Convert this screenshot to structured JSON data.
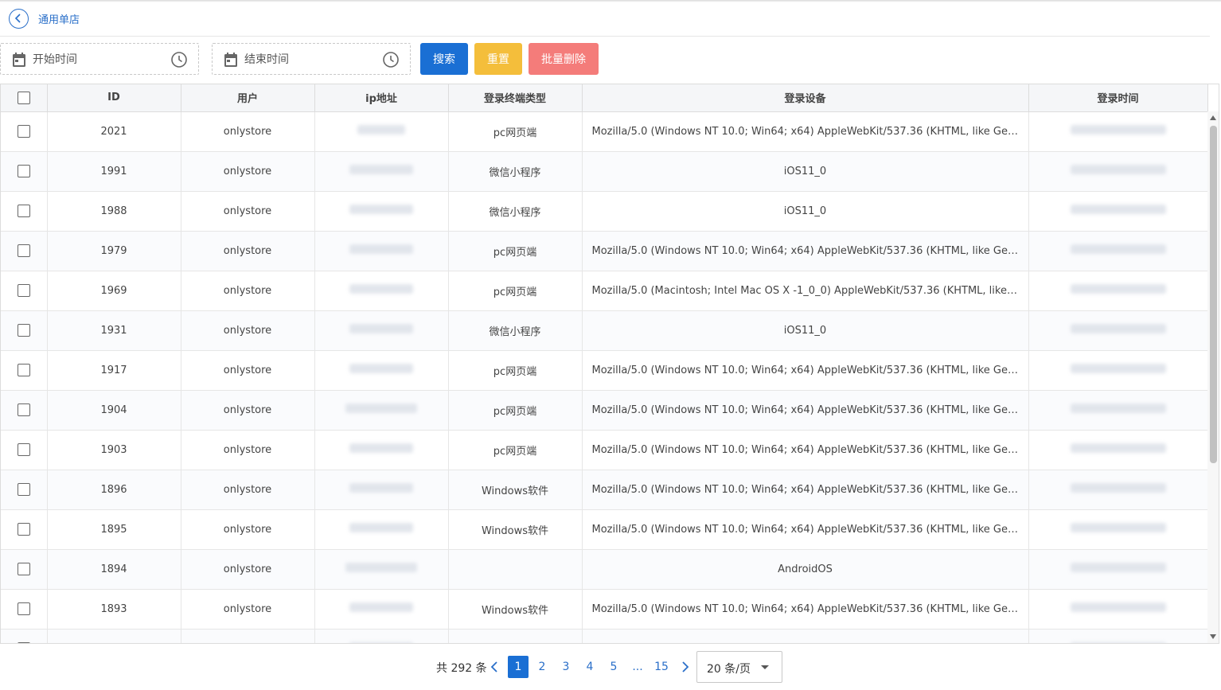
{
  "header": {
    "title": "通用单店"
  },
  "filters": {
    "start_placeholder": "开始时间",
    "end_placeholder": "结束时间",
    "search_label": "搜索",
    "reset_label": "重置",
    "batch_delete_label": "批量删除"
  },
  "colors": {
    "primary": "#1a6fd4",
    "warning": "#f4be3b",
    "danger": "#f47c7a",
    "link": "#2a6fc9"
  },
  "table": {
    "columns": [
      "ID",
      "用户",
      "ip地址",
      "登录终端类型",
      "登录设备",
      "登录时间"
    ],
    "rows": [
      {
        "id": "2021",
        "user": "onlystore",
        "terminal": "pc网页端",
        "device": "Mozilla/5.0 (Windows NT 10.0; Win64; x64) AppleWebKit/537.36 (KHTML, like Gecko) ..."
      },
      {
        "id": "1991",
        "user": "onlystore",
        "terminal": "微信小程序",
        "device": "iOS11_0"
      },
      {
        "id": "1988",
        "user": "onlystore",
        "terminal": "微信小程序",
        "device": "iOS11_0"
      },
      {
        "id": "1979",
        "user": "onlystore",
        "terminal": "pc网页端",
        "device": "Mozilla/5.0 (Windows NT 10.0; Win64; x64) AppleWebKit/537.36 (KHTML, like Gecko) ..."
      },
      {
        "id": "1969",
        "user": "onlystore",
        "terminal": "pc网页端",
        "device": "Mozilla/5.0 (Macintosh; Intel Mac OS X -1_0_0) AppleWebKit/537.36 (KHTML, like Gec..."
      },
      {
        "id": "1931",
        "user": "onlystore",
        "terminal": "微信小程序",
        "device": "iOS11_0"
      },
      {
        "id": "1917",
        "user": "onlystore",
        "terminal": "pc网页端",
        "device": "Mozilla/5.0 (Windows NT 10.0; Win64; x64) AppleWebKit/537.36 (KHTML, like Gecko) ..."
      },
      {
        "id": "1904",
        "user": "onlystore",
        "terminal": "pc网页端",
        "device": "Mozilla/5.0 (Windows NT 10.0; Win64; x64) AppleWebKit/537.36 (KHTML, like Gecko) ..."
      },
      {
        "id": "1903",
        "user": "onlystore",
        "terminal": "pc网页端",
        "device": "Mozilla/5.0 (Windows NT 10.0; Win64; x64) AppleWebKit/537.36 (KHTML, like Gecko) ..."
      },
      {
        "id": "1896",
        "user": "onlystore",
        "terminal": "Windows软件",
        "device": "Mozilla/5.0 (Windows NT 10.0; Win64; x64) AppleWebKit/537.36 (KHTML, like Gecko) ..."
      },
      {
        "id": "1895",
        "user": "onlystore",
        "terminal": "Windows软件",
        "device": "Mozilla/5.0 (Windows NT 10.0; Win64; x64) AppleWebKit/537.36 (KHTML, like Gecko) ..."
      },
      {
        "id": "1894",
        "user": "onlystore",
        "terminal": "",
        "device": "AndroidOS"
      },
      {
        "id": "1893",
        "user": "onlystore",
        "terminal": "Windows软件",
        "device": "Mozilla/5.0 (Windows NT 10.0; Win64; x64) AppleWebKit/537.36 (KHTML, like Gecko) ..."
      },
      {
        "id": "",
        "user": "",
        "terminal": "",
        "device": ""
      }
    ]
  },
  "pagination": {
    "total_text": "共 292 条",
    "pages": [
      "1",
      "2",
      "3",
      "4",
      "5",
      "...",
      "15"
    ],
    "current": "1",
    "page_size_label": "20 条/页"
  }
}
